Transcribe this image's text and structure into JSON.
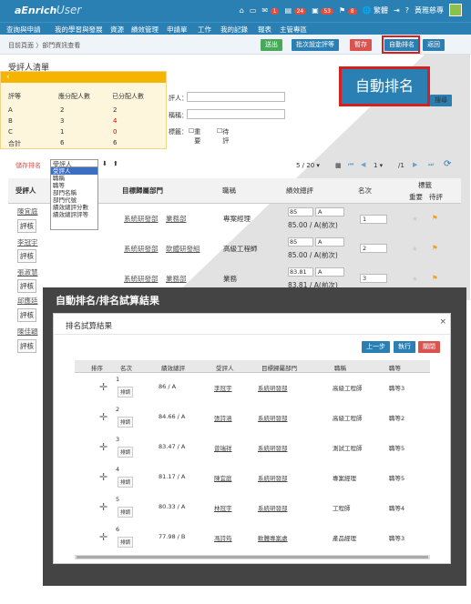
{
  "header": {
    "logo": "aEnrich",
    "logo_user": "User",
    "badges": [
      "1",
      "24",
      "53",
      "8"
    ],
    "lang": "繁體",
    "user": "黃雅慈專"
  },
  "menu": [
    "查詢與申請",
    "我的學習與發展",
    "資源",
    "績效管理",
    "申請單",
    "工作",
    "我的記錄",
    "報表",
    "主管專區"
  ],
  "breadcrumb": "目前頁面 〉部門資訊查看",
  "toolbar": {
    "submit": "送出",
    "batch": "批次設定評等",
    "save": "暫存",
    "auto_rank": "自動排名",
    "back": "返回"
  },
  "callout": "自動排名",
  "page_title": "受評人清單",
  "stat_panel": {
    "cols": [
      "評等",
      "應分配人數",
      "已分配人數"
    ],
    "rows": [
      [
        "A",
        "2",
        "2"
      ],
      [
        "B",
        "3",
        "4"
      ],
      [
        "C",
        "1",
        "0"
      ],
      [
        "合計",
        "6",
        "6"
      ]
    ]
  },
  "filters": {
    "reviewee": "評人：",
    "title": "稱稱：",
    "tags": "標籤：",
    "tag1": "重要",
    "tag2": "待評",
    "query": "搜尋"
  },
  "sort": {
    "batch_label": "儲存排名",
    "selected": "受評人",
    "options": [
      "受評人",
      "職稱",
      "職等",
      "部門名稱",
      "部門代號",
      "績效總評分數",
      "績效總評評等"
    ],
    "pager": "5 / 20 ▾",
    "page": "1 ▾",
    "total_pages": "/1"
  },
  "grid": {
    "headers": [
      "受評人",
      "目標歸屬部門",
      "職稱",
      "績效總評",
      "名次",
      "標籤",
      "重要",
      "待評"
    ],
    "rows": [
      {
        "name": "陳宜庭",
        "dept": "系統研發部",
        "dept2": "業務部",
        "title": "專案經理",
        "score": "85",
        "grade": "A",
        "note": "85.00 / A(前次)",
        "rank": "1"
      },
      {
        "name": "李冠宇",
        "dept": "系統研發部",
        "dept2": "軟體研發組",
        "title": "高級工程師",
        "score": "85",
        "grade": "A",
        "note": "85.00 / A(前次)",
        "rank": "2"
      },
      {
        "name": "張淑慧",
        "dept": "系統研發部",
        "dept2": "業務部",
        "title": "業務",
        "score": "83.81",
        "grade": "A",
        "note": "83.81 / A(前次)",
        "rank": "3"
      },
      {
        "name": "邱應廷",
        "dept": "",
        "dept2": "",
        "title": "",
        "score": "",
        "grade": "",
        "note": "",
        "rank": ""
      },
      {
        "name": "陳佳穎",
        "dept": "",
        "dept2": "",
        "title": "",
        "score": "",
        "grade": "",
        "note": "",
        "rank": ""
      }
    ],
    "eval_btn": "評核"
  },
  "overlay": {
    "title": "自動排名/排名試算結果",
    "dialog_title": "排名試算結果",
    "buttons": {
      "prev": "上一步",
      "run": "執行",
      "close": "關閉"
    },
    "headers": [
      "排序",
      "名次",
      "績效總評",
      "受評人",
      "目標歸屬部門",
      "職稱",
      "職等"
    ],
    "adjust": "排調",
    "rows": [
      {
        "rank": "1",
        "score": "86 / A",
        "name": "李冠宇",
        "dept": "系統研發部",
        "title": "高級工程師",
        "level": "職等3"
      },
      {
        "rank": "2",
        "score": "84.66 / A",
        "name": "張詩涵",
        "dept": "系統研發部",
        "title": "高級工程師",
        "level": "職等2"
      },
      {
        "rank": "3",
        "score": "83.47 / A",
        "name": "曾瑞祥",
        "dept": "系統研發部",
        "title": "測試工程師",
        "level": "職等5"
      },
      {
        "rank": "4",
        "score": "81.17 / A",
        "name": "陳宜庭",
        "dept": "系統研發部",
        "title": "專案經理",
        "level": "職等5"
      },
      {
        "rank": "5",
        "score": "80.33 / A",
        "name": "林冠宇",
        "dept": "系統研發部",
        "title": "工程師",
        "level": "職等4"
      },
      {
        "rank": "6",
        "score": "77.98 / B",
        "name": "馮詩筠",
        "dept": "軟體專案處",
        "title": "產品經理",
        "level": "職等3"
      }
    ]
  }
}
